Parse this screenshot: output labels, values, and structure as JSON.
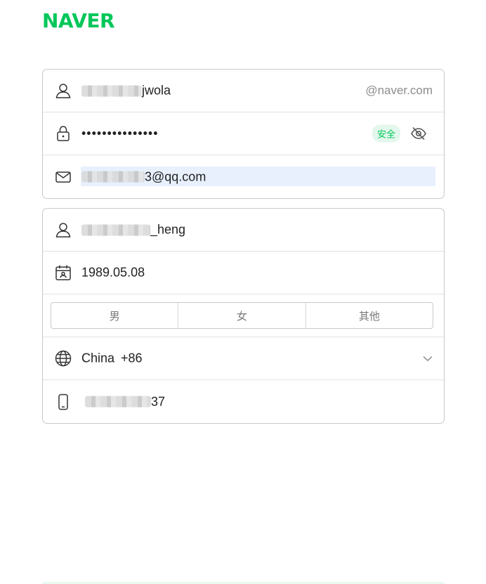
{
  "brand": {
    "logo": "NAVER",
    "color": "#03c75a"
  },
  "account": {
    "id_visible": "jwola",
    "id_suffix": "@naver.com",
    "password_masked": "•••••••••••••••",
    "password_strength": "安全",
    "email_visible": "3@qq.com"
  },
  "profile": {
    "name_visible": "_heng",
    "birthday": "1989.05.08",
    "gender_options": [
      "男",
      "女",
      "其他"
    ],
    "country": "China",
    "country_code": "+86",
    "phone_visible": "37"
  },
  "icons": {
    "id": "user-icon",
    "password": "lock-icon",
    "email": "mail-icon",
    "name": "user-icon",
    "birthday": "calendar-icon",
    "country": "globe-icon",
    "phone": "phone-icon",
    "visibility": "eye-off-icon",
    "dropdown": "chevron-down-icon"
  }
}
